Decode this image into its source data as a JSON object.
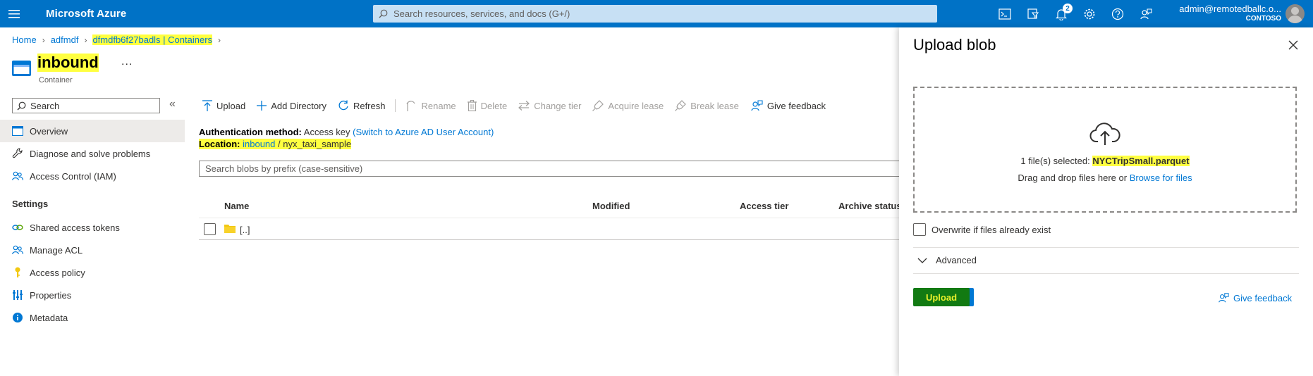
{
  "topbar": {
    "brand": "Microsoft Azure",
    "search_placeholder": "Search resources, services, and docs (G+/)",
    "notification_count": "2",
    "account_name": "admin@remotedballc.o...",
    "account_tenant": "CONTOSO"
  },
  "breadcrumb": {
    "home": "Home",
    "factory": "adfmdf",
    "storage": "dfmdfb6f27badls | Containers"
  },
  "header": {
    "title": "inbound",
    "more": "...",
    "subtitle": "Container"
  },
  "sidebar": {
    "search_placeholder": "Search",
    "collapse": "«",
    "items": [
      {
        "label": "Overview",
        "icon": "overview-icon"
      },
      {
        "label": "Diagnose and solve problems",
        "icon": "wrench-icon"
      },
      {
        "label": "Access Control (IAM)",
        "icon": "people-icon"
      }
    ],
    "settings_heading": "Settings",
    "settings_items": [
      {
        "label": "Shared access tokens",
        "icon": "link-icon"
      },
      {
        "label": "Manage ACL",
        "icon": "people-icon"
      },
      {
        "label": "Access policy",
        "icon": "key-icon"
      },
      {
        "label": "Properties",
        "icon": "sliders-icon"
      },
      {
        "label": "Metadata",
        "icon": "info-icon"
      }
    ]
  },
  "toolbar": {
    "upload": "Upload",
    "add_directory": "Add Directory",
    "refresh": "Refresh",
    "rename": "Rename",
    "delete": "Delete",
    "change_tier": "Change tier",
    "acquire_lease": "Acquire lease",
    "break_lease": "Break lease",
    "give_feedback": "Give feedback"
  },
  "info": {
    "auth_label": "Authentication method:",
    "auth_value": "Access key",
    "auth_link": "(Switch to Azure AD User Account)",
    "location_label": "Location:",
    "location_container": "inbound",
    "location_sep": "/",
    "location_folder": "nyx_taxi_sample"
  },
  "blob_search_placeholder": "Search blobs by prefix (case-sensitive)",
  "table": {
    "columns": [
      "Name",
      "Modified",
      "Access tier",
      "Archive status"
    ],
    "rows": [
      {
        "name": "[..]"
      }
    ]
  },
  "panel": {
    "title": "Upload blob",
    "files_selected_prefix": "1 file(s) selected:",
    "file_name": "NYCTripSmall.parquet",
    "drag_text": "Drag and drop files here",
    "or_text": "or",
    "browse_link": "Browse for files",
    "overwrite_label": "Overwrite if files already exist",
    "advanced_label": "Advanced",
    "upload_button": "Upload",
    "give_feedback": "Give feedback"
  },
  "colors": {
    "topbar": "#0072c6",
    "accent": "#0078d4",
    "highlight": "#ffff40"
  }
}
